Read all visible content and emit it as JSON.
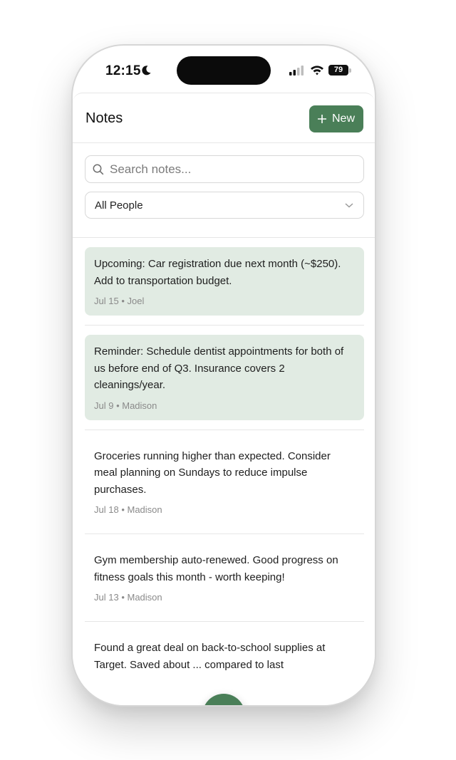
{
  "status_bar": {
    "time": "12:15",
    "battery": "79"
  },
  "header": {
    "title": "Notes",
    "new_label": "New"
  },
  "search": {
    "placeholder": "Search notes...",
    "value": ""
  },
  "filter": {
    "selected": "All People"
  },
  "notes": [
    {
      "text": "Upcoming: Car registration due next month (~$250). Add to transportation budget.",
      "date": "Jul 15",
      "person": "Joel",
      "highlighted": true
    },
    {
      "text": "Reminder: Schedule dentist appointments for both of us before end of Q3. Insurance covers 2 cleanings/year.",
      "date": "Jul 9",
      "person": "Madison",
      "highlighted": true
    },
    {
      "text": "Groceries running higher than expected. Consider meal planning on Sundays to reduce impulse purchases.",
      "date": "Jul 18",
      "person": "Madison",
      "highlighted": false
    },
    {
      "text": "Gym membership auto-renewed. Good progress on fitness goals this month - worth keeping!",
      "date": "Jul 13",
      "person": "Madison",
      "highlighted": false
    },
    {
      "text": "Found a great deal on back-to-school supplies at Target. Saved about ... compared to last",
      "date": "",
      "person": "",
      "highlighted": false
    }
  ],
  "icons": {
    "moon": "moon-icon",
    "signal": "signal-icon",
    "wifi": "wifi-icon",
    "search": "search-icon",
    "chevron": "chevron-down-icon",
    "plus": "plus-icon",
    "close": "close-icon"
  },
  "colors": {
    "accent": "#4a7f58",
    "highlight_bg": "#e1ebe3"
  }
}
